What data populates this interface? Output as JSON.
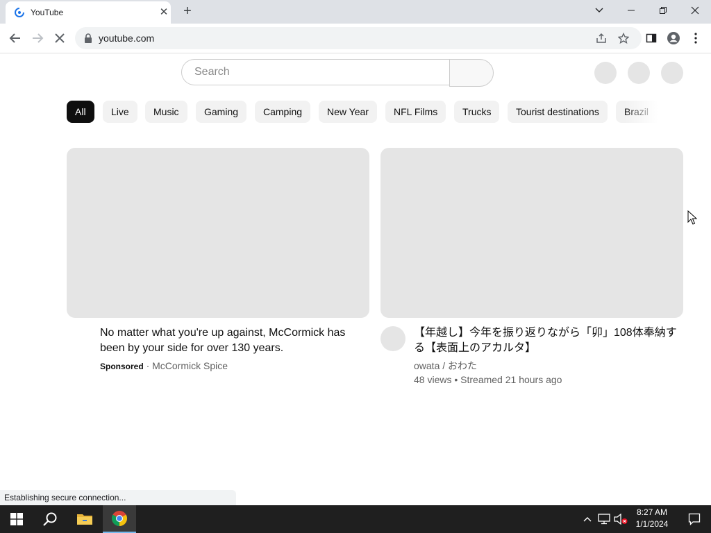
{
  "browser": {
    "tab_title": "YouTube",
    "url": "youtube.com",
    "status_text": "Establishing secure connection..."
  },
  "youtube": {
    "search_placeholder": "Search",
    "chips": [
      "All",
      "Live",
      "Music",
      "Gaming",
      "Camping",
      "New Year",
      "NFL Films",
      "Trucks",
      "Tourist destinations",
      "Brazil"
    ],
    "active_chip": "All",
    "videos": [
      {
        "title": "No matter what you're up against, McCormick has been by your side for over 130 years.",
        "sponsored_label": "Sponsored",
        "separator": "·",
        "channel": "McCormick Spice"
      },
      {
        "title": "【年越し】今年を振り返りながら「卯」108体奉納する【表面上のアカルタ】",
        "channel": "owata / おわた",
        "stats": "48 views • Streamed 21 hours ago"
      }
    ]
  },
  "taskbar": {
    "time": "8:27 AM",
    "date": "1/1/2024"
  },
  "icons": {
    "tab_favicon": "loading-spinner-icon",
    "accent": "#1a73e8",
    "taskbar_bg": "#1f1f1f"
  }
}
